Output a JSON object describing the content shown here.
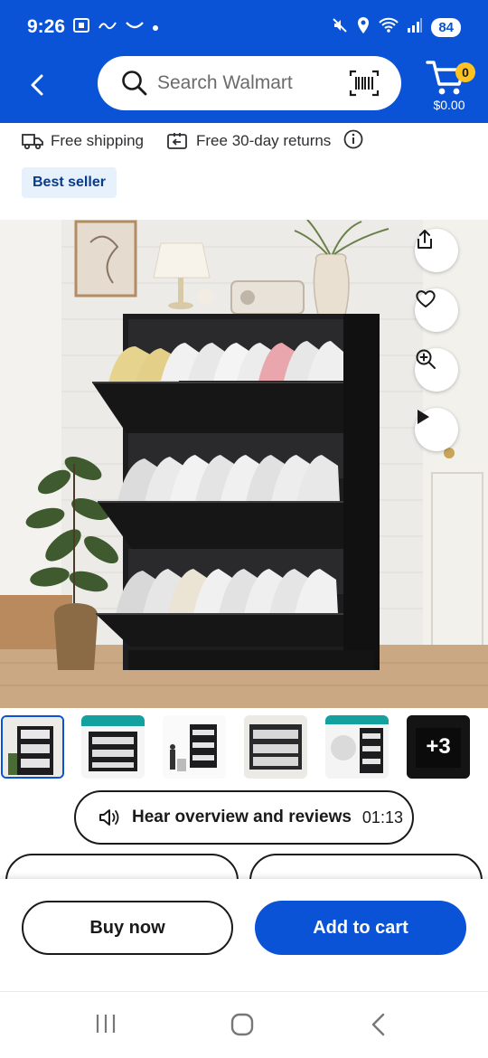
{
  "status_bar": {
    "time": "9:26",
    "battery": "84"
  },
  "header": {
    "search_placeholder": "Search Walmart",
    "cart_count": "0",
    "cart_total": "$0.00"
  },
  "info_row": {
    "shipping": "Free shipping",
    "returns": "Free 30-day returns"
  },
  "badge": "Best seller",
  "thumbnails": {
    "more_label": "+3"
  },
  "hear_overview": {
    "label": "Hear overview and reviews",
    "duration": "01:13"
  },
  "actions": {
    "buy_now": "Buy now",
    "add_to_cart": "Add to cart"
  },
  "colors": {
    "brand_blue": "#0a53d6",
    "cart_badge": "#ffc220",
    "badge_bg": "#e6f1fc"
  },
  "icons": [
    "back-icon",
    "search-icon",
    "barcode-scan-icon",
    "cart-icon",
    "truck-icon",
    "return-icon",
    "info-icon",
    "share-icon",
    "heart-icon",
    "zoom-icon",
    "play-icon",
    "speaker-icon",
    "recents-icon",
    "home-icon",
    "nav-back-icon"
  ]
}
